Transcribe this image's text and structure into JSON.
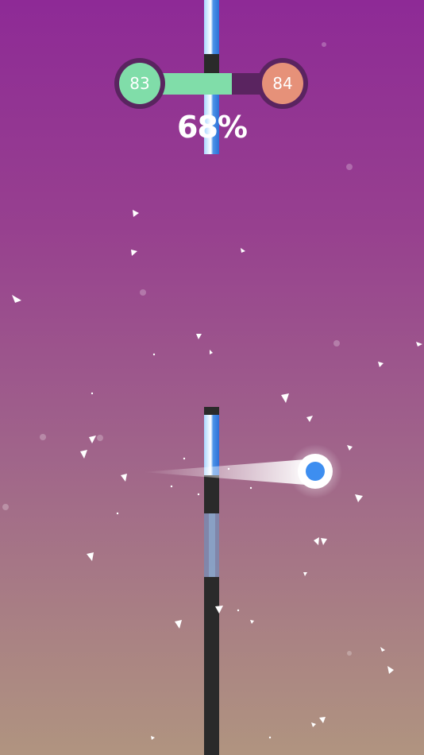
{
  "hud": {
    "current_level": "83",
    "next_level": "84",
    "progress_text": "68%",
    "progress_fraction": 0.68
  },
  "colors": {
    "current_level": "#80dda9",
    "next_level": "#e69179",
    "progress_track": "#5a2460",
    "pillar_dark": "#2a2a2a",
    "pillar_blue": "#4a93e8",
    "ball": "#3d8ef0"
  },
  "icons": {
    "ball": "ball-icon",
    "particles": "triangle-shard-icon"
  }
}
